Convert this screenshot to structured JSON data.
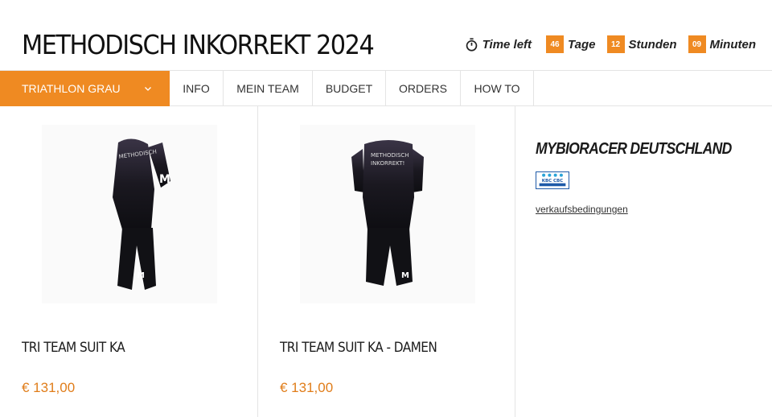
{
  "header": {
    "title": "METHODISCH INKORREKT 2024",
    "countdown": {
      "label": "Time left",
      "days_value": "46",
      "days_label": "Tage",
      "hours_value": "12",
      "hours_label": "Stunden",
      "minutes_value": "09",
      "minutes_label": "Minuten"
    }
  },
  "nav": {
    "dropdown_label": "TRIATHLON GRAU",
    "items": [
      "INFO",
      "MEIN TEAM",
      "BUDGET",
      "ORDERS",
      "HOW TO"
    ]
  },
  "products": [
    {
      "name": "TRI TEAM SUIT KA",
      "price": "€ 131,00",
      "image_icon": "tri-suit-image"
    },
    {
      "name": "TRI TEAM SUIT KA - DAMEN",
      "price": "€ 131,00",
      "image_icon": "tri-suit-image"
    }
  ],
  "sidebar": {
    "vendor_name": "MYBIORACER DEUTSCHLAND",
    "payment_logo_text": "KBC CBC",
    "terms_link": "verkaufsbedingungen"
  },
  "colors": {
    "accent": "#ef8a22",
    "price": "#e07d1a",
    "border": "#e4e4e4"
  }
}
